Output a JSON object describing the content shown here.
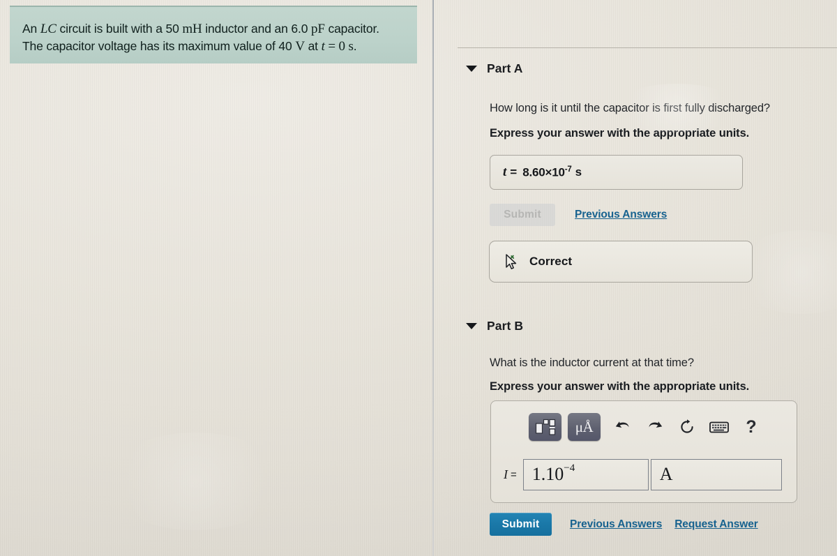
{
  "problem": {
    "line1_pre": "An ",
    "line1_math": "LC",
    "line1_mid": " circuit is built with a 50 ",
    "line1_unit1": "mH",
    "line1_mid2": " inductor and an 6.0 ",
    "line1_unit2": "pF",
    "line1_end": " capacitor.",
    "line2_pre": "The capacitor voltage has its maximum value of 40 ",
    "line2_unit": "V",
    "line2_mid": " at ",
    "line2_var": "t",
    "line2_eq": " = 0 ",
    "line2_unit2": "s",
    "line2_period": "."
  },
  "part_a": {
    "title": "Part A",
    "question": "How long is it until the capacitor is first fully discharged?",
    "instruction": "Express your answer with the appropriate units.",
    "answer": {
      "variable": "t",
      "equals": "=",
      "mantissa": "8.60×10",
      "exponent": "-7",
      "unit": "s"
    },
    "submit_label": "Submit",
    "submit_disabled": true,
    "previous_answers_label": "Previous Answers",
    "feedback": {
      "icon": "cursor-arrow-icon",
      "label": "Correct"
    }
  },
  "part_b": {
    "title": "Part B",
    "question": "What is the inductor current at that time?",
    "instruction": "Express your answer with the appropriate units.",
    "toolbar": [
      {
        "name": "template-button",
        "type": "key",
        "label": ""
      },
      {
        "name": "micro-angstrom-button",
        "type": "key",
        "label": "μÅ"
      },
      {
        "name": "undo-icon",
        "type": "icon",
        "label": "undo"
      },
      {
        "name": "redo-icon",
        "type": "icon",
        "label": "redo"
      },
      {
        "name": "reset-icon",
        "type": "icon",
        "label": "reset"
      },
      {
        "name": "keyboard-icon",
        "type": "icon",
        "label": "keyboard"
      },
      {
        "name": "help-icon",
        "type": "icon",
        "label": "?"
      }
    ],
    "input": {
      "variable": "I",
      "equals": "=",
      "value_mantissa": "1.10",
      "value_exponent": "−4",
      "unit": "A"
    },
    "submit_label": "Submit",
    "previous_answers_label": "Previous Answers",
    "request_answer_label": "Request Answer"
  },
  "colors": {
    "page_background": "#e8e4db",
    "problem_background": "#bcd2ca",
    "link": "#17628f",
    "submit_active": "#1a78a8",
    "submit_disabled_text": "#b6b6b4",
    "toolbar_key": "#5f6170",
    "text": "#1a1c1f"
  }
}
